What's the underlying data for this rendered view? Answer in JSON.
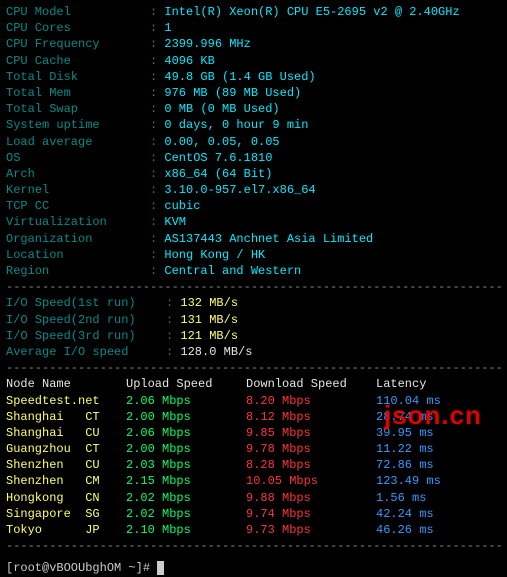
{
  "sysinfo": [
    {
      "label": "CPU Model",
      "value": "Intel(R) Xeon(R) CPU E5-2695 v2 @ 2.40GHz"
    },
    {
      "label": "CPU Cores",
      "value": "1"
    },
    {
      "label": "CPU Frequency",
      "value": "2399.996 MHz"
    },
    {
      "label": "CPU Cache",
      "value": "4096 KB"
    },
    {
      "label": "Total Disk",
      "value": "49.8 GB (1.4 GB Used)"
    },
    {
      "label": "Total Mem",
      "value": "976 MB (89 MB Used)"
    },
    {
      "label": "Total Swap",
      "value": "0 MB (0 MB Used)"
    },
    {
      "label": "System uptime",
      "value": "0 days, 0 hour 9 min"
    },
    {
      "label": "Load average",
      "value": "0.00, 0.05, 0.05"
    },
    {
      "label": "OS",
      "value": "CentOS 7.6.1810"
    },
    {
      "label": "Arch",
      "value": "x86_64 (64 Bit)"
    },
    {
      "label": "Kernel",
      "value": "3.10.0-957.el7.x86_64"
    },
    {
      "label": "TCP CC",
      "value": "cubic"
    },
    {
      "label": "Virtualization",
      "value": "KVM"
    },
    {
      "label": "Organization",
      "value": "AS137443 Anchnet Asia Limited"
    },
    {
      "label": "Location",
      "value": "Hong Kong / HK"
    },
    {
      "label": "Region",
      "value": "Central and Western"
    }
  ],
  "io": [
    {
      "label": "I/O Speed(1st run)",
      "value": "132 MB/s",
      "cls": "val-yellow"
    },
    {
      "label": "I/O Speed(2nd run)",
      "value": "131 MB/s",
      "cls": "val-yellow"
    },
    {
      "label": "I/O Speed(3rd run)",
      "value": "121 MB/s",
      "cls": "val-yellow"
    },
    {
      "label": "Average I/O speed",
      "value": "128.0 MB/s",
      "cls": "val-white"
    }
  ],
  "speed_header": {
    "node": "Node Name",
    "upload": "Upload Speed",
    "download": "Download Speed",
    "latency": "Latency"
  },
  "speedtest": [
    {
      "node": "Speedtest.net",
      "up": "2.06 Mbps",
      "dn": "8.20 Mbps",
      "lat": "110.04 ms"
    },
    {
      "node": "Shanghai   CT",
      "up": "2.00 Mbps",
      "dn": "8.12 Mbps",
      "lat": "28.74 ms"
    },
    {
      "node": "Shanghai   CU",
      "up": "2.06 Mbps",
      "dn": "9.85 Mbps",
      "lat": "39.95 ms"
    },
    {
      "node": "Guangzhou  CT",
      "up": "2.00 Mbps",
      "dn": "9.78 Mbps",
      "lat": "11.22 ms"
    },
    {
      "node": "Shenzhen   CU",
      "up": "2.03 Mbps",
      "dn": "8.28 Mbps",
      "lat": "72.86 ms"
    },
    {
      "node": "Shenzhen   CM",
      "up": "2.15 Mbps",
      "dn": "10.05 Mbps",
      "lat": "123.49 ms"
    },
    {
      "node": "Hongkong   CN",
      "up": "2.02 Mbps",
      "dn": "9.88 Mbps",
      "lat": "1.56 ms"
    },
    {
      "node": "Singapore  SG",
      "up": "2.02 Mbps",
      "dn": "9.74 Mbps",
      "lat": "42.24 ms"
    },
    {
      "node": "Tokyo      JP",
      "up": "2.10 Mbps",
      "dn": "9.73 Mbps",
      "lat": "46.26 ms"
    }
  ],
  "divider": "----------------------------------------------------------------------",
  "prompt": "[root@vBOOUbghOM ~]# ",
  "watermark": "json.cn"
}
